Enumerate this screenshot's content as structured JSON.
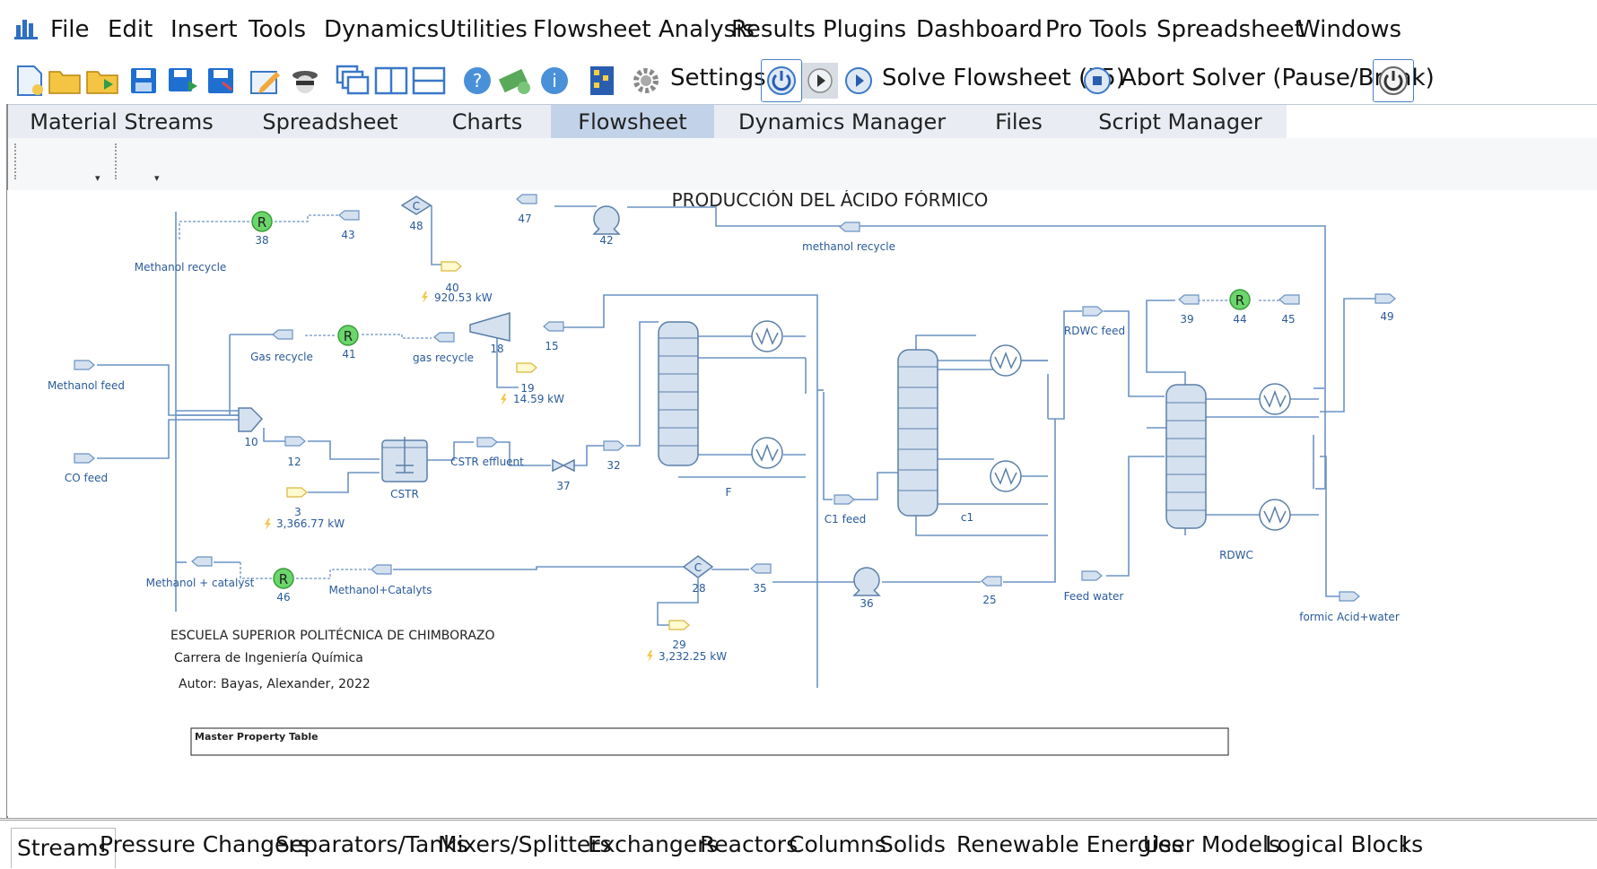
{
  "menu": [
    "File",
    "Edit",
    "Insert",
    "Tools",
    "Dynamics",
    "Utilities",
    "Flowsheet Analysis",
    "Results",
    "Plugins",
    "Dashboard",
    "Pro Tools",
    "Spreadsheet",
    "Windows"
  ],
  "toolbar": {
    "settings_label": "Settings",
    "solve_label": "Solve Flowsheet (F5)",
    "abort_label": "Abort Solver (Pause/Break)"
  },
  "tabs": [
    "Material Streams",
    "Spreadsheet",
    "Charts",
    "Flowsheet",
    "Dynamics Manager",
    "Files",
    "Script Manager"
  ],
  "active_tab": "Flowsheet",
  "flowsheet": {
    "title": "PRODUCCIÓN DEL ÁCIDO FÓRMICO",
    "credits": [
      "ESCUELA SUPERIOR POLITÉCNICA DE CHIMBORAZO",
      "Carrera de Ingeniería Química",
      "Autor: Bayas, Alexander, 2022"
    ],
    "master_table_label": "Master Property Table",
    "recycle_symbol": "R",
    "compressor_symbol": "C",
    "labels": {
      "s38": "38",
      "s43": "43",
      "s48": "48",
      "s47": "47",
      "s42": "42",
      "methanol_recycle_top": "methanol  recycle",
      "methanol_recycle_left": "Methanol recycle",
      "s40": "40",
      "e40": "920.53 kW",
      "gas_recycle_left": "Gas recycle",
      "s41": "41",
      "gas_recycle_mid": "gas recycle",
      "s18": "18",
      "s15": "15",
      "s19": "19",
      "e19": "14.59 kW",
      "methanol_feed": "Methanol feed",
      "co_feed": "CO feed",
      "s10": "10",
      "s12": "12",
      "cstr": "CSTR",
      "cstr_effluent": "CSTR effluent",
      "s37": "37",
      "s32": "32",
      "s3": "3",
      "e3": "3,366.77 kW",
      "col_f": "F",
      "c1_feed": "C1 feed",
      "col_c1": "c1",
      "rdwc_feed": "RDWC feed",
      "s39": "39",
      "s44": "44",
      "s45": "45",
      "s49": "49",
      "col_rdwc": "RDWC",
      "feed_water": "Feed water",
      "formic_water": "formic Acid+water",
      "methanol_catalyst": "Methanol + catalyst",
      "s46": "46",
      "methanol_catalyts": "Methanol+Catalyts",
      "s28": "28",
      "s35": "35",
      "s36": "36",
      "s25": "25",
      "s29": "29",
      "e29": "3,232.25 kW"
    }
  },
  "bottom_tabs": [
    "Streams",
    "Pressure Changers",
    "Separators/Tanks",
    "Mixers/Splitters",
    "Exchangers",
    "Reactors",
    "Columns",
    "Solids",
    "Renewable Energies",
    "User Models",
    "Logical Blocks",
    "I"
  ],
  "active_bottom_tab": "Streams",
  "colors": {
    "accent": "#4a7fc4",
    "tab_active": "#c2d3e9",
    "stream": "#6c93c4",
    "recycle": "#5fd35f"
  }
}
